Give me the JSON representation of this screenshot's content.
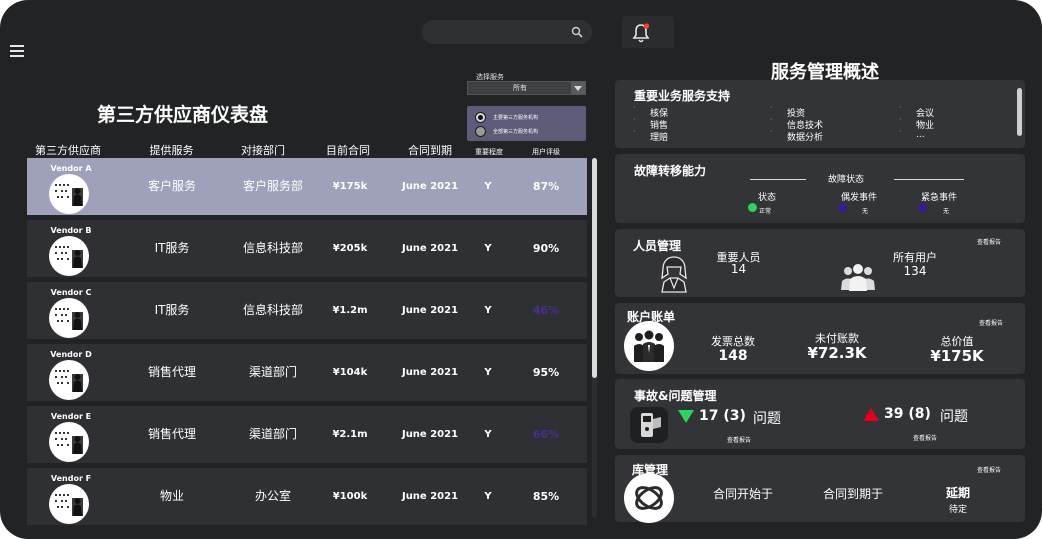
{
  "colors": {
    "background": "#222325",
    "card": "#333437",
    "row": "#2f3033",
    "row_selected": "#9fa0b9",
    "filter_box": "#5d5b78",
    "green": "#2fd15f",
    "red": "#e3001b",
    "purple": "#3a1a8e",
    "alert": "#ff3b30"
  },
  "header": {
    "search": {
      "placeholder": "",
      "icon": "search-icon"
    },
    "notification": {
      "icon": "bell-icon",
      "has_alert": true
    },
    "menu_icon": "hamburger-menu-icon"
  },
  "dashboard": {
    "title": "第三方供应商仪表盘",
    "filter": {
      "label": "选择服务",
      "selected": "所有",
      "options": [
        "主要第三方服务机构",
        "全部第三方服务机构"
      ]
    },
    "columns": [
      "第三方供应商",
      "提供服务",
      "对接部门",
      "目前合同",
      "合同到期",
      "重要程度",
      "用户评级"
    ],
    "vendors": [
      {
        "name": "Vendor A",
        "service": "客户服务",
        "department": "客户服务部",
        "contract": "¥175k",
        "expiry": "June 2021",
        "critical": "Y",
        "rating": "87%",
        "rating_color": "white",
        "selected": true
      },
      {
        "name": "Vendor B",
        "service": "IT服务",
        "department": "信息科技部",
        "contract": "¥205k",
        "expiry": "June 2021",
        "critical": "Y",
        "rating": "90%",
        "rating_color": "white",
        "selected": false
      },
      {
        "name": "Vendor C",
        "service": "IT服务",
        "department": "信息科技部",
        "contract": "¥1.2m",
        "expiry": "June 2021",
        "critical": "Y",
        "rating": "46%",
        "rating_color": "purple",
        "selected": false
      },
      {
        "name": "Vendor D",
        "service": "销售代理",
        "department": "渠道部门",
        "contract": "¥104k",
        "expiry": "June 2021",
        "critical": "Y",
        "rating": "95%",
        "rating_color": "white",
        "selected": false
      },
      {
        "name": "Vendor E",
        "service": "销售代理",
        "department": "渠道部门",
        "contract": "¥2.1m",
        "expiry": "June 2021",
        "critical": "Y",
        "rating": "66%",
        "rating_color": "purple",
        "selected": false
      },
      {
        "name": "Vendor F",
        "service": "物业",
        "department": "办公室",
        "contract": "¥100k",
        "expiry": "June 2021",
        "critical": "Y",
        "rating": "85%",
        "rating_color": "white",
        "selected": false
      }
    ]
  },
  "overview": {
    "title": "服务管理概述",
    "services": {
      "title": "重要业务服务支持",
      "columns": [
        [
          "核保",
          "销售",
          "理赔"
        ],
        [
          "投资",
          "信息技术",
          "数据分析"
        ],
        [
          "会议",
          "物业",
          "..."
        ]
      ]
    },
    "failover": {
      "title": "故障转移能力",
      "header": "故障状态",
      "items": [
        {
          "label": "状态",
          "value": "正常",
          "color": "green"
        },
        {
          "label": "偶发事件",
          "value": "无",
          "color": "purple"
        },
        {
          "label": "紧急事件",
          "value": "无",
          "color": "purple"
        }
      ]
    },
    "people": {
      "title": "人员管理",
      "link": "查看报告",
      "key_staff_label": "重要人员",
      "key_staff_value": "14",
      "all_users_label": "所有用户",
      "all_users_value": "134"
    },
    "accounts": {
      "title": "账户账单",
      "link": "查看报告",
      "invoices_label": "发票总数",
      "invoices_value": "148",
      "unpaid_label": "未付账款",
      "unpaid_value": "¥72.3K",
      "total_label": "总价值",
      "total_value": "¥175K"
    },
    "incidents": {
      "title": "事故&问题管理",
      "down_value": "17 (3)",
      "down_label": "问题",
      "down_link": "查看报告",
      "up_value": "39 (8)",
      "up_label": "问题",
      "up_link": "查看报告"
    },
    "library": {
      "title": "库管理",
      "link": "查看报告",
      "start_label": "合同开始于",
      "end_label": "合同到期于",
      "extension_label": "延期",
      "extension_value": "待定"
    }
  }
}
